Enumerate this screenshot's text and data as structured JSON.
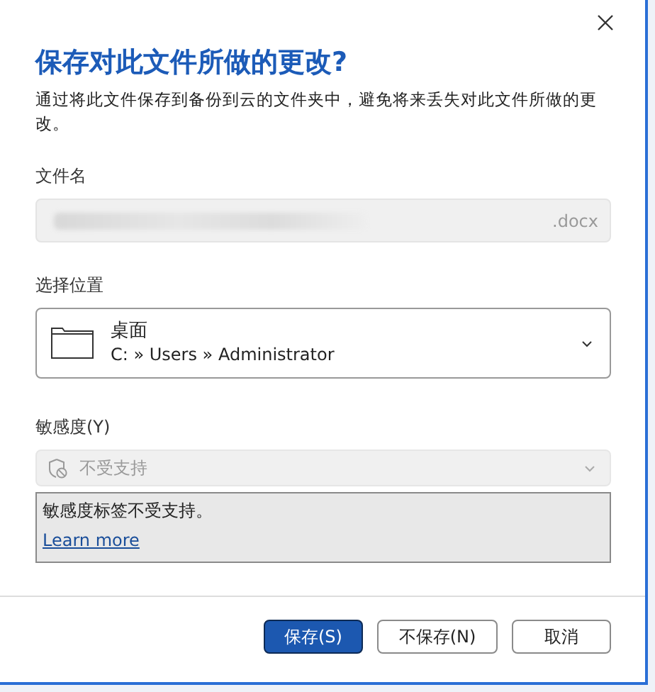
{
  "dialog": {
    "title": "保存对此文件所做的更改?",
    "description": "通过将此文件保存到备份到云的文件夹中，避免将来丢失对此文件所做的更改。"
  },
  "file_name": {
    "label": "文件名",
    "extension": ".docx",
    "redacted": true
  },
  "location": {
    "label": "选择位置",
    "name": "桌面",
    "path": "C: » Users » Administrator"
  },
  "sensitivity": {
    "label": "敏感度(Y)",
    "value": "不受支持",
    "disabled": true,
    "message": "敏感度标签不受支持。",
    "link": "Learn more"
  },
  "buttons": [
    {
      "label": "保存(S)",
      "primary": true
    },
    {
      "label": "不保存(N)",
      "primary": false
    },
    {
      "label": "取消",
      "primary": false
    }
  ]
}
